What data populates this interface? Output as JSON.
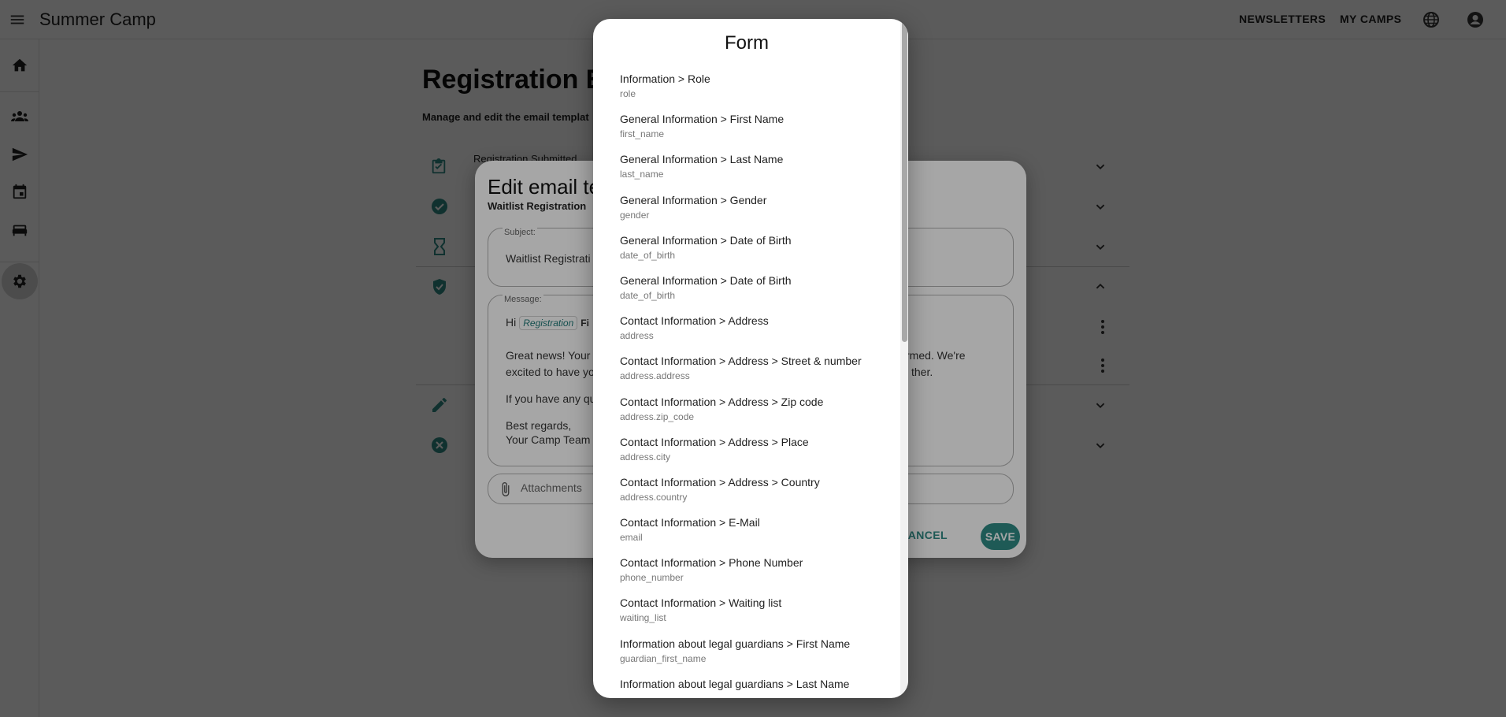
{
  "app": {
    "title": "Summer Camp",
    "nav": [
      "NEWSLETTERS",
      "MY CAMPS"
    ]
  },
  "page": {
    "title": "Registration E",
    "subtitle": "Manage and edit the email templat",
    "rows": [
      {
        "icon": "clipboard-check-icon",
        "label": "Registration Submitted"
      },
      {
        "icon": "check-circle-icon",
        "label": ""
      },
      {
        "icon": "hourglass-icon",
        "label": ""
      },
      {
        "icon": "shield-check-icon",
        "label": ""
      },
      {
        "icon": "pencil-icon",
        "label": ""
      },
      {
        "icon": "cancel-circle-icon",
        "label": ""
      }
    ]
  },
  "dialog": {
    "title": "Edit email te",
    "subtitle": "Waitlist Registration",
    "subject_label": "Subject:",
    "subject_value": "Waitlist Registrati",
    "message_label": "Message:",
    "message": {
      "greeting": "Hi",
      "chip": "Registration",
      "chip_tail": "Fi",
      "line1_left": "Great news! Your",
      "line1_right": "firmed. We're",
      "line2_left": "excited to have yo",
      "line2_right": "ther.",
      "line3": "If you have any qu",
      "line4": "Best regards,",
      "line5": "Your Camp Team"
    },
    "attachments_placeholder": "Attachments",
    "cancel_label": "CANCEL",
    "save_label": "SAVE"
  },
  "picker": {
    "title": "Form",
    "items": [
      {
        "label": "Information > Role",
        "key": "role"
      },
      {
        "label": "General Information > First Name",
        "key": "first_name"
      },
      {
        "label": "General Information > Last Name",
        "key": "last_name"
      },
      {
        "label": "General Information > Gender",
        "key": "gender"
      },
      {
        "label": "General Information > Date of Birth",
        "key": "date_of_birth"
      },
      {
        "label": "General Information > Date of Birth",
        "key": "date_of_birth"
      },
      {
        "label": "Contact Information > Address",
        "key": "address"
      },
      {
        "label": "Contact Information > Address > Street & number",
        "key": "address.address"
      },
      {
        "label": "Contact Information > Address > Zip code",
        "key": "address.zip_code"
      },
      {
        "label": "Contact Information > Address > Place",
        "key": "address.city"
      },
      {
        "label": "Contact Information > Address > Country",
        "key": "address.country"
      },
      {
        "label": "Contact Information > E-Mail",
        "key": "email"
      },
      {
        "label": "Contact Information > Phone Number",
        "key": "phone_number"
      },
      {
        "label": "Contact Information > Waiting list",
        "key": "waiting_list"
      },
      {
        "label": "Information about legal guardians > First Name",
        "key": "guardian_first_name"
      },
      {
        "label": "Information about legal guardians > Last Name",
        "key": ""
      }
    ]
  },
  "colors": {
    "accent": "#2f8a85",
    "backdrop": "rgba(0,0,0,0.45)"
  }
}
